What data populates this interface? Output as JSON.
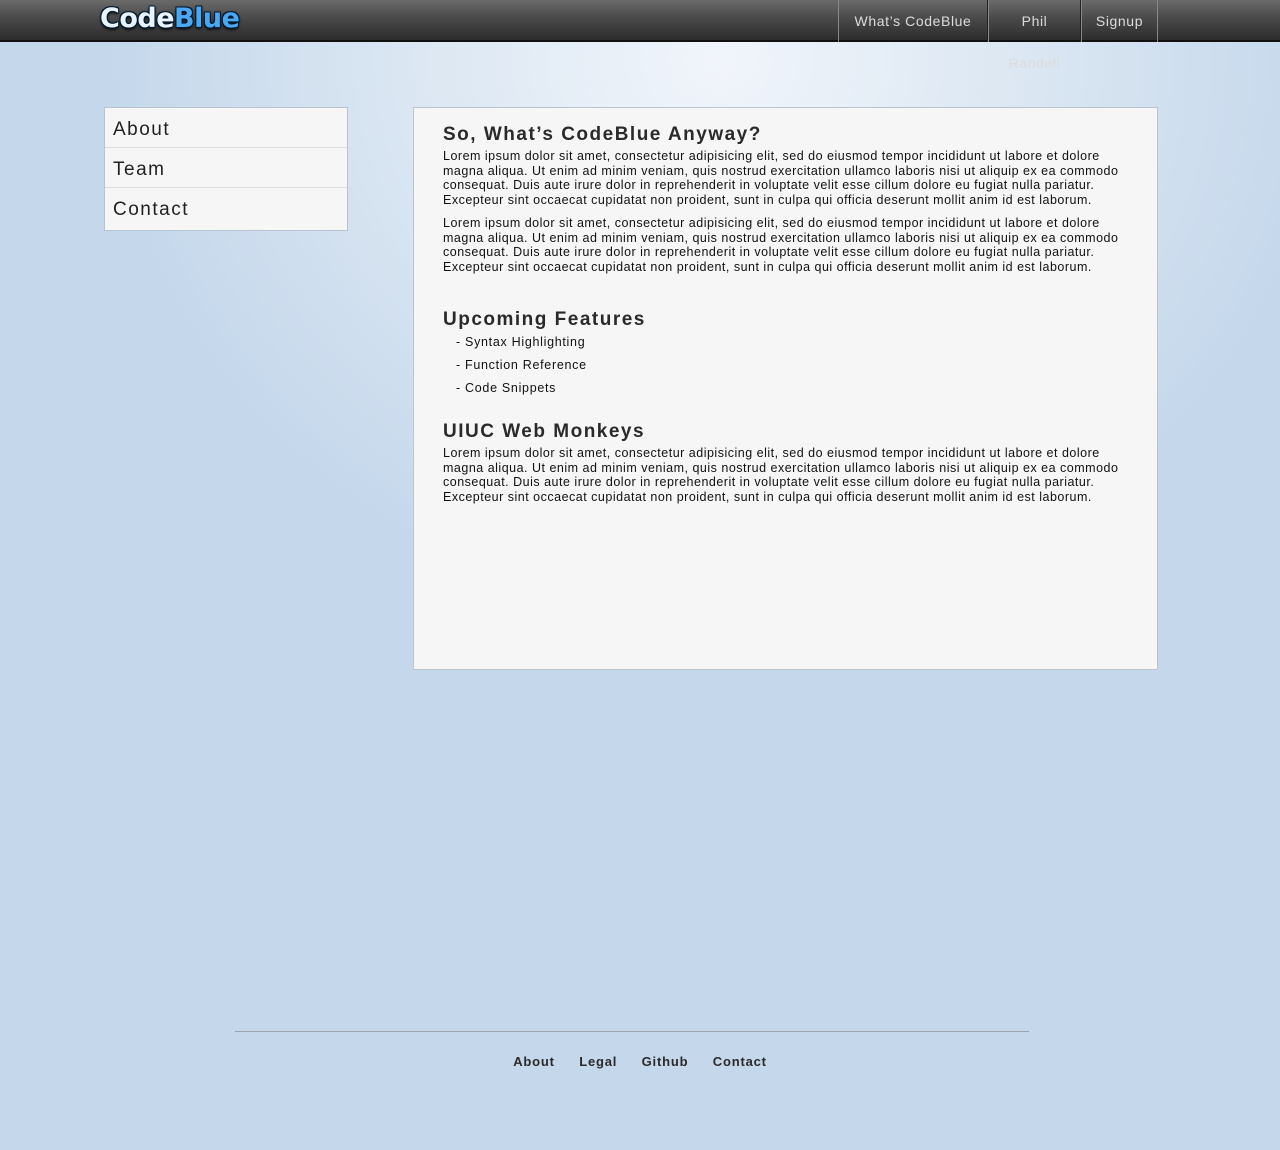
{
  "header": {
    "logo": {
      "part1": "Code",
      "part2": "Blue"
    },
    "nav": [
      "What’s CodeBlue",
      "Phil Randell",
      "Signup"
    ]
  },
  "sidebar": {
    "items": [
      "About",
      "Team",
      "Contact"
    ]
  },
  "main": {
    "section1": {
      "title": "So, What’s CodeBlue Anyway?",
      "p1": "Lorem ipsum dolor sit amet, consectetur adipisicing elit, sed do eiusmod tempor incididunt ut labore et dolore magna aliqua. Ut enim ad minim veniam, quis nostrud exercitation ullamco laboris nisi ut aliquip ex ea commodo consequat. Duis aute irure dolor in reprehenderit in voluptate velit esse cillum dolore eu fugiat nulla pariatur. Excepteur sint occaecat cupidatat non proident, sunt in culpa qui officia deserunt mollit anim id est laborum.",
      "p2": "Lorem ipsum dolor sit amet, consectetur adipisicing elit, sed do eiusmod tempor incididunt ut labore et dolore magna aliqua. Ut enim ad minim veniam, quis nostrud exercitation ullamco laboris nisi ut aliquip ex ea commodo consequat. Duis aute irure dolor in reprehenderit in voluptate velit esse cillum dolore eu fugiat nulla pariatur. Excepteur sint occaecat cupidatat non proident, sunt in culpa qui officia deserunt mollit anim id est laborum."
    },
    "section2": {
      "title": "Upcoming Features",
      "items": [
        "- Syntax Highlighting",
        "- Function Reference",
        "- Code Snippets"
      ]
    },
    "section3": {
      "title": "UIUC Web Monkeys",
      "p1": "Lorem ipsum dolor sit amet, consectetur adipisicing elit, sed do eiusmod tempor incididunt ut labore et dolore magna aliqua. Ut enim ad minim veniam, quis nostrud exercitation ullamco laboris nisi ut aliquip ex ea commodo consequat. Duis aute irure dolor in reprehenderit in voluptate velit esse cillum dolore eu fugiat nulla pariatur. Excepteur sint occaecat cupidatat non proident, sunt in culpa qui officia deserunt mollit anim id est laborum."
    }
  },
  "footer": {
    "links": [
      "About",
      "Legal",
      "Github",
      "Contact"
    ]
  },
  "colors": {
    "brand_light": "#e9f3ff",
    "brand_blue": "#4aa8f0",
    "background": "#c4d7eb",
    "panel": "#f6f6f6"
  }
}
